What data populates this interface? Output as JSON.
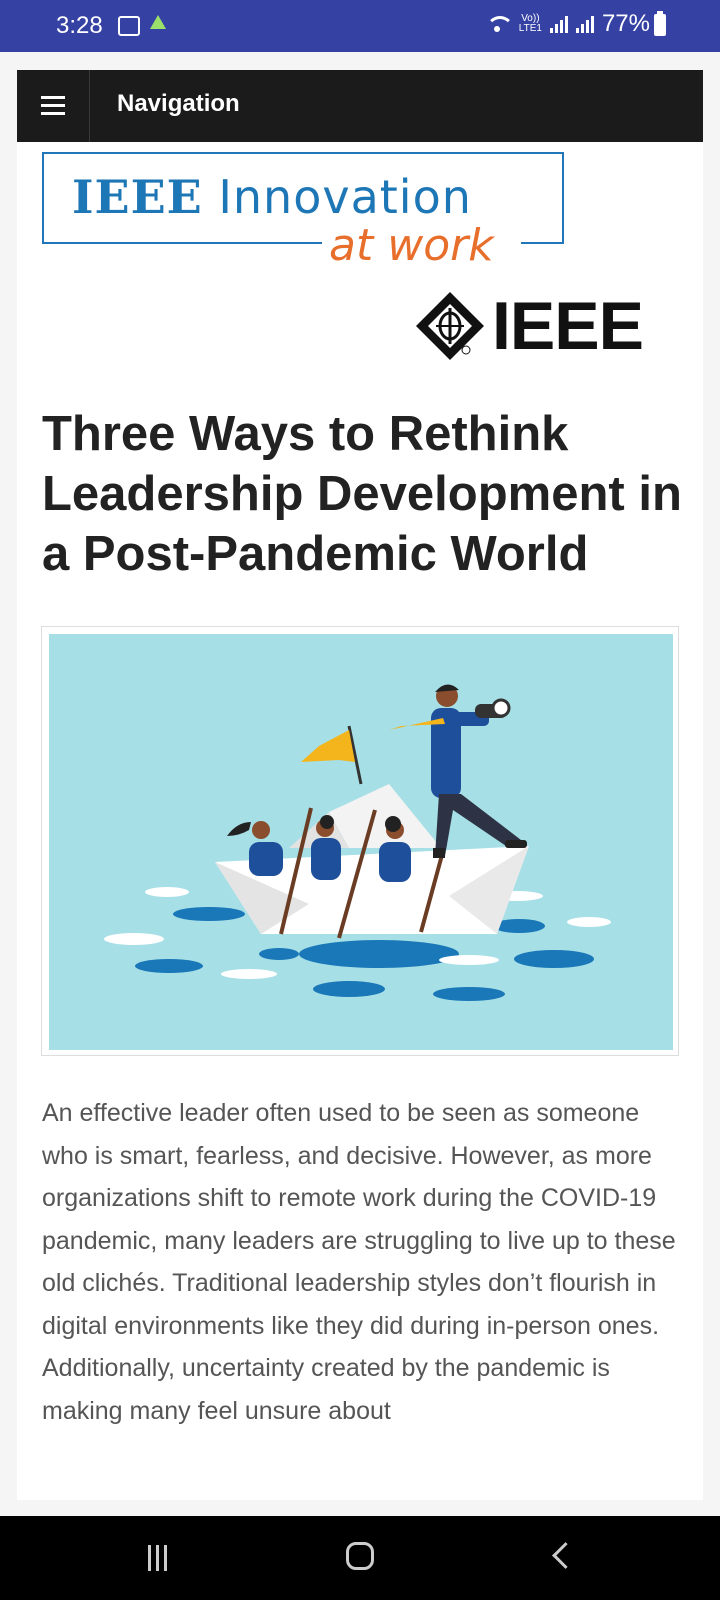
{
  "status_bar": {
    "time": "3:28",
    "volte_top": "Vo))",
    "volte_bottom": "LTE1",
    "battery": "77%",
    "icons": [
      "gallery-icon",
      "drive-icon",
      "wifi-icon",
      "signal-icon",
      "battery-icon"
    ]
  },
  "header": {
    "menu_icon": "hamburger-icon",
    "nav_label": "Navigation"
  },
  "logos": {
    "innovation_line1_a": "IEEE",
    "innovation_line1_b": " Innovation",
    "innovation_line2": "at work",
    "ieee_wordmark": "IEEE"
  },
  "article": {
    "title": "Three Ways to Rethink Leadership Development in a Post-Pandemic World",
    "image_subject": "business team rowing a paper boat with leader holding a telescope",
    "body": "An effective leader often used to be seen as someone who is smart, fearless, and decisive. However, as more organizations shift to remote work during the COVID-19 pandemic, many leaders are struggling to live up to these old clichés. Traditional leadership styles don’t flourish in digital environments like they did during in-person ones. Additionally, uncertainty created by the pandemic is making many feel unsure about"
  },
  "colors": {
    "status_bar": "#3542a3",
    "navbar": "#1b1b1b",
    "ieee_blue": "#1d76b5",
    "accent_orange": "#e86e2c",
    "hero_bg": "#a6dfe6"
  },
  "system_nav": {
    "icons": [
      "recent-apps-icon",
      "home-icon",
      "back-icon"
    ]
  }
}
